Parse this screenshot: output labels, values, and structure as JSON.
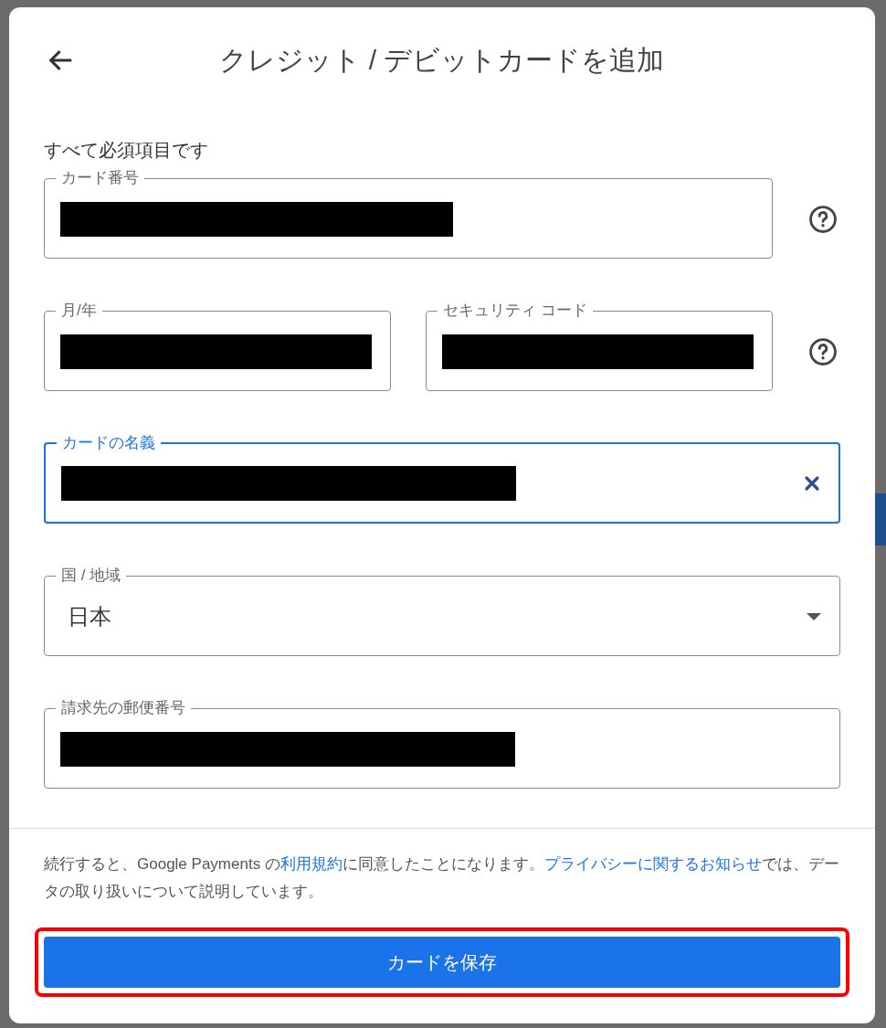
{
  "dialog": {
    "title": "クレジット / デビットカードを追加",
    "required_note": "すべて必須項目です",
    "rows": [
      {
        "fields": [
          {
            "kind": "text",
            "label": "カード番号",
            "redacted": true,
            "focused": false
          }
        ],
        "help": true
      },
      {
        "fields": [
          {
            "kind": "text",
            "label": "月/年",
            "redacted": true,
            "focused": false
          },
          {
            "kind": "text",
            "label": "セキュリティ コード",
            "redacted": true,
            "focused": false
          }
        ],
        "help": true
      },
      {
        "fields": [
          {
            "kind": "clearable",
            "label": "カードの名義",
            "redacted": true,
            "focused": true
          }
        ],
        "help": false
      },
      {
        "fields": [
          {
            "kind": "select",
            "label": "国 / 地域",
            "value": "日本",
            "focused": false
          }
        ],
        "help": false
      },
      {
        "fields": [
          {
            "kind": "text",
            "label": "請求先の郵便番号",
            "redacted": true,
            "focused": false
          }
        ],
        "help": false
      }
    ],
    "terms": [
      {
        "kind": "text",
        "text": "続行すると、Google Payments の"
      },
      {
        "kind": "link",
        "text": "利用規約"
      },
      {
        "kind": "text",
        "text": "に同意したことになります。"
      },
      {
        "kind": "link",
        "text": "プライバシーに関するお知らせ"
      },
      {
        "kind": "text",
        "text": "では、データの取り扱いについて説明しています。"
      }
    ],
    "save_button": {
      "label": "カードを保存",
      "highlighted": true
    }
  }
}
